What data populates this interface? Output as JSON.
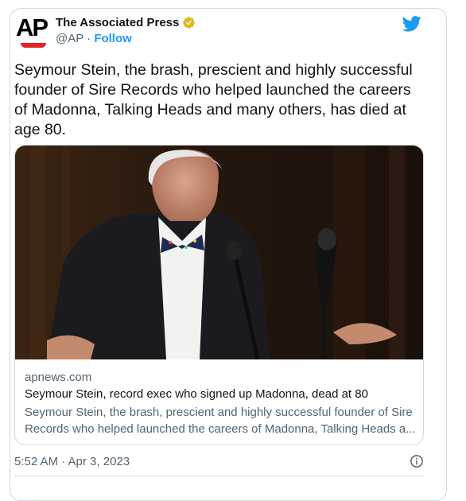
{
  "account": {
    "logo_text": "AP",
    "name": "The Associated Press",
    "handle": "@AP",
    "separator": "·",
    "follow_label": "Follow"
  },
  "tweet": {
    "text": "Seymour Stein, the brash, prescient and highly successful founder of Sire Records who helped launched the careers of Madonna, Talking Heads and many others, has died at age 80."
  },
  "link_card": {
    "domain": "apnews.com",
    "title": "Seymour Stein, record exec who signed up Madonna, dead at 80",
    "description": "Seymour Stein, the brash, prescient and highly successful founder of Sire Records who helped launched the careers of Madonna, Talking Heads a..."
  },
  "footer": {
    "timestamp": "5:52 AM · Apr 3, 2023"
  },
  "icons": {
    "verified": "verified-badge-icon",
    "platform": "twitter-bird-icon",
    "info": "info-icon"
  },
  "colors": {
    "accent": "#1d9bf0",
    "verified_gold": "#e2b719",
    "logo_red": "#e3242b",
    "secondary_text": "#536471",
    "border": "#cfd9de"
  }
}
